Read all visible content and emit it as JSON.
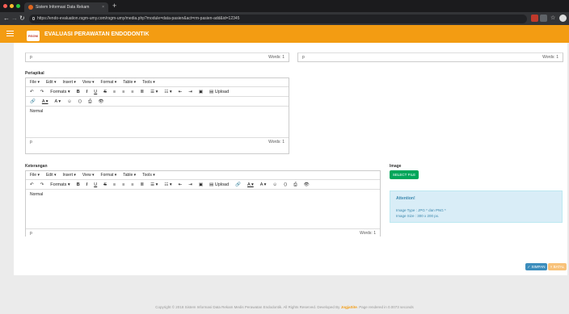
{
  "browser": {
    "tab_title": "Sistem Informasi Data Rekam",
    "tab_close": "×",
    "new_tab": "+",
    "url": "https://endo-evaluation.rsgm-umy.com/rsgm-umy/media.php?module=data-pasien&act=rm-pasien-add&id=12345",
    "colors": {
      "close": "#ff5f57",
      "min": "#febc2e",
      "max": "#28c840"
    }
  },
  "app": {
    "logo_text": "RSGM",
    "title": "EVALUASI PERAWATAN ENDODONTIK",
    "accent": "#f39c12"
  },
  "top_editors": {
    "left": {
      "path": "p",
      "words": "Words: 1"
    },
    "right": {
      "path": "p",
      "words": "Words: 1"
    }
  },
  "menu": {
    "file": "File ▾",
    "edit": "Edit ▾",
    "insert": "Insert ▾",
    "view": "View ▾",
    "format": "Format ▾",
    "table": "Table ▾",
    "tools": "Tools ▾"
  },
  "toolbar": {
    "undo": "↶",
    "redo": "↷",
    "formats": "Formats ▾",
    "bold": "B",
    "italic": "I",
    "underline": "U",
    "strike": "S",
    "align_left": "≡",
    "align_center": "≡",
    "align_right": "≡",
    "justify": "≣",
    "bullets": "☰ ▾",
    "numbers": "☷ ▾",
    "outdent": "⇤",
    "indent": "⇥",
    "image": "▣",
    "upload": "Upload",
    "link": "🔗",
    "text_color": "A ▾",
    "bg_color": "A ▾",
    "emoticons": "☺",
    "code": "⟨⟩",
    "print": "⎙",
    "preview": "👁"
  },
  "periapikal": {
    "label": "Periapikal",
    "content": "Normal",
    "path": "p",
    "words": "Words: 1"
  },
  "keterangan": {
    "label": "Keterangan",
    "content": "Normal",
    "path": "p",
    "words": "Words: 1"
  },
  "image_section": {
    "label": "Image",
    "select_button": "SELECT FILE",
    "alert_title": "Attention!",
    "type_line": "Image Type : JPG * dan PNG *",
    "size_line": "Image Size : 300 x 200 px."
  },
  "actions": {
    "save": "✓ SIMPAN",
    "cancel": "× BATAL",
    "save_color": "#3c8dbc",
    "cancel_color": "#f8c27a"
  },
  "footer": {
    "text": "Copyright © 2018 Sistem Informasi Data Rekam Medis Perawatan Endodontik. All Rights Reserved. Developed By",
    "brand": "JogjaSite",
    "suffix": ". Page rendered in 0.0073 seconds"
  }
}
